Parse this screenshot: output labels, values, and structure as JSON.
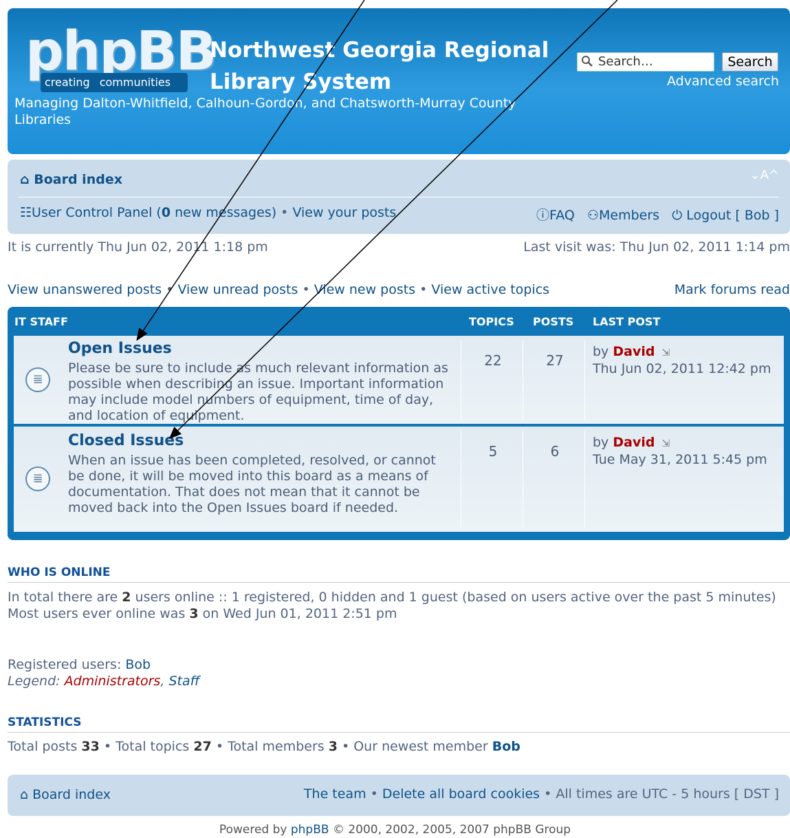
{
  "header": {
    "logo_main": "phpBB",
    "logo_tag_left": "creating",
    "logo_tag_right": "communities",
    "title_line1": "Northwest Georgia Regional",
    "title_line2": "Library System",
    "description": "Managing Dalton-Whitfield, Calhoun-Gordon, and Chatsworth-Murray County Libraries",
    "search_placeholder": "Search…",
    "search_button": "Search",
    "advanced_search": "Advanced search"
  },
  "navbar": {
    "board_index": "Board index",
    "font_controls": "⌄A^",
    "ucp_label": "User Control Panel (",
    "ucp_count": "0",
    "ucp_suffix": " new messages)",
    "view_posts": "View your posts",
    "faq": "FAQ",
    "members": "Members",
    "logout": "Logout [ Bob ]"
  },
  "time_line": "It is currently Thu Jun 02, 2011 1:18 pm",
  "last_visit": "Last visit was: Thu Jun 02, 2011 1:14 pm",
  "quick_links": [
    "View unanswered posts",
    "View unread posts",
    "View new posts",
    "View active topics"
  ],
  "mark_read": "Mark forums read",
  "forum_table": {
    "headers": {
      "category": "IT STAFF",
      "topics": "TOPICS",
      "posts": "POSTS",
      "last_post": "LAST POST"
    },
    "forums": [
      {
        "title": "Open Issues",
        "description": "Please be sure to include as much relevant information as possible when describing an issue. Important information may include model numbers of equipment, time of day, and location of equipment.",
        "topics": "22",
        "posts": "27",
        "by": "by",
        "author": "David",
        "date": "Thu Jun 02, 2011 12:42 pm"
      },
      {
        "title": "Closed Issues",
        "description": "When an issue has been completed, resolved, or cannot be done, it will be moved into this board as a means of documentation. That does not mean that it cannot be moved back into the Open Issues board if needed.",
        "topics": "5",
        "posts": "6",
        "by": "by",
        "author": "David",
        "date": "Tue May 31, 2011 5:45 pm"
      }
    ]
  },
  "who_online": {
    "heading": "WHO IS ONLINE",
    "line1_a": "In total there are ",
    "line1_b": "2",
    "line1_c": " users online :: 1 registered, 0 hidden and 1 guest (based on users active over the past 5 minutes)",
    "line2_a": "Most users ever online was ",
    "line2_b": "3",
    "line2_c": " on Wed Jun 01, 2011 2:51 pm",
    "registered_label": "Registered users: ",
    "registered_user": "Bob",
    "legend_label": "Legend: ",
    "legend_admin": "Administrators",
    "legend_sep": ", ",
    "legend_staff": "Staff"
  },
  "statistics": {
    "heading": "STATISTICS",
    "posts_label": "Total posts ",
    "posts": "33",
    "topics_label": " • Total topics ",
    "topics": "27",
    "members_label": " • Total members ",
    "members": "3",
    "newest_label": " • Our newest member ",
    "newest": "Bob"
  },
  "footer": {
    "board_index": "Board index",
    "team": "The team",
    "delete_cookies": "Delete all board cookies",
    "times": "All times are UTC - 5 hours [ DST ]",
    "powered_a": "Powered by ",
    "powered_link": "phpBB",
    "powered_b": " © 2000, 2002, 2005, 2007 phpBB Group"
  }
}
